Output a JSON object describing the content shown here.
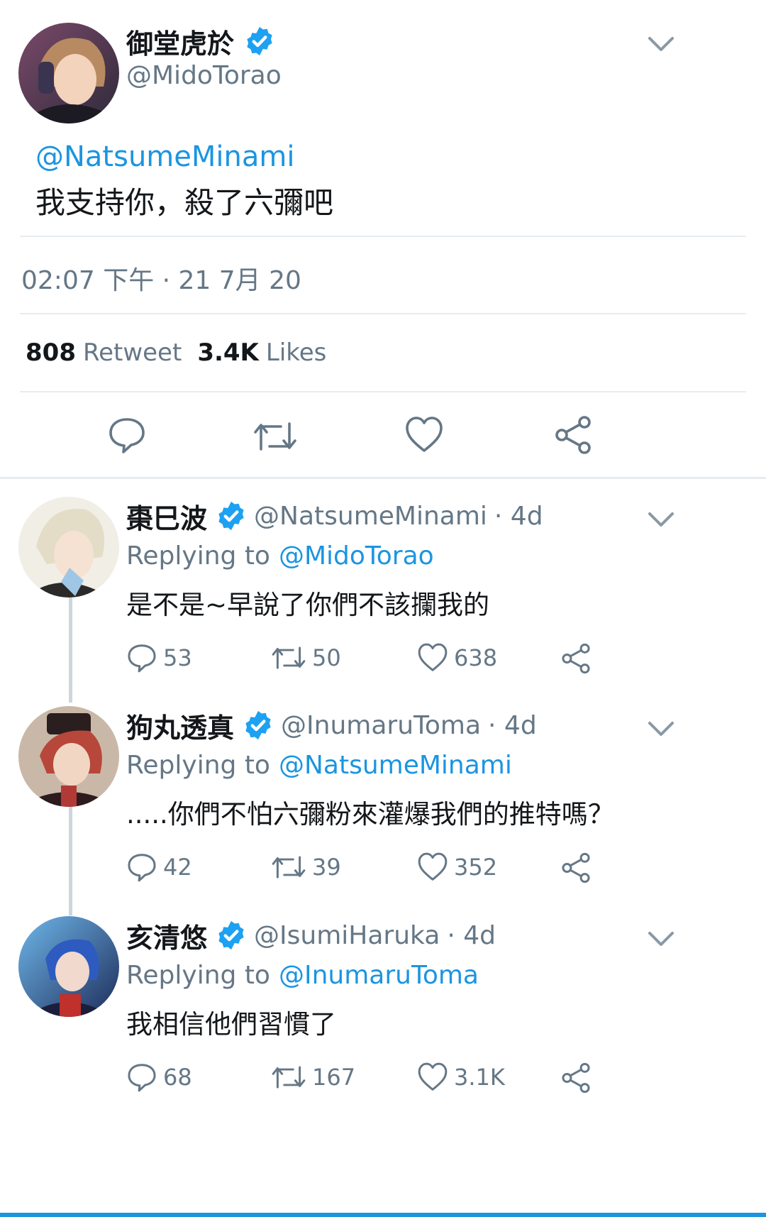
{
  "main_tweet": {
    "author_name": "御堂虎於",
    "author_handle": "@MidoTorao",
    "mention": "@NatsumeMinami",
    "text": "我支持你，殺了六彌吧",
    "timestamp": "02:07 下午 · 21 7月 20",
    "retweet_count": "808",
    "retweet_label": "Retweet",
    "like_count": "3.4K",
    "like_label": "Likes"
  },
  "replies": [
    {
      "author_name": "棗巳波",
      "author_handle": "@NatsumeMinami",
      "age": "· 4d",
      "replying_label": "Replying to",
      "replying_to": "@MidoTorao",
      "text": "是不是~早說了你們不該攔我的",
      "reply_count": "53",
      "retweet_count": "50",
      "like_count": "638"
    },
    {
      "author_name": "狗丸透真",
      "author_handle": "@InumaruToma",
      "age": "· 4d",
      "replying_label": "Replying to",
      "replying_to": "@NatsumeMinami",
      "text": ".....你們不怕六彌粉來灌爆我們的推特嗎？",
      "reply_count": "42",
      "retweet_count": "39",
      "like_count": "352"
    },
    {
      "author_name": "亥清悠",
      "author_handle": "@IsumiHaruka",
      "age": "· 4d",
      "replying_label": "Replying to",
      "replying_to": "@InumaruToma",
      "text": "我相信他們習慣了",
      "reply_count": "68",
      "retweet_count": "167",
      "like_count": "3.1K"
    }
  ],
  "colors": {
    "accent": "#1b95e0",
    "secondary_text": "#657786",
    "verified": "#1da1f2",
    "divider": "#e6ecf0"
  },
  "icons": [
    "chevron-down-icon",
    "verified-badge-icon",
    "reply-icon",
    "retweet-icon",
    "like-icon",
    "share-icon"
  ]
}
